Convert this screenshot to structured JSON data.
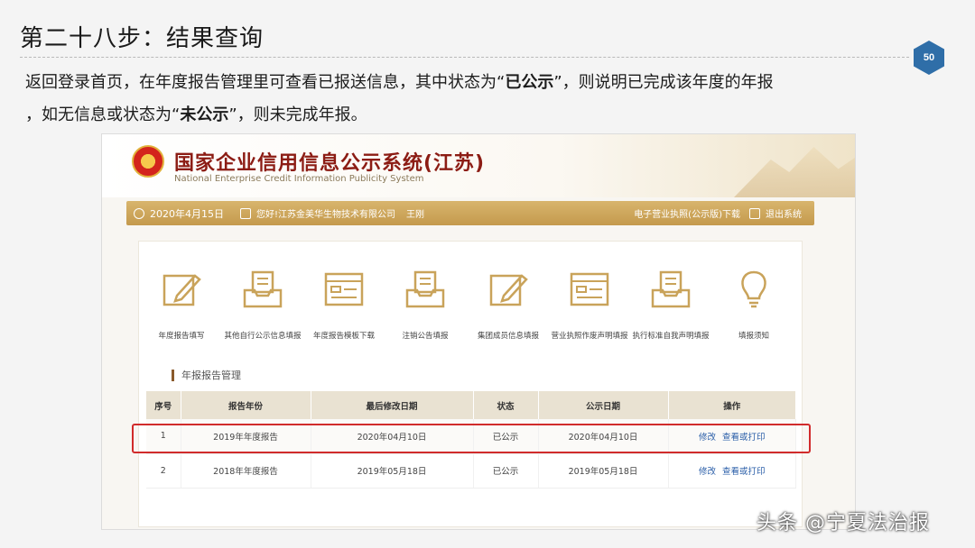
{
  "slide": {
    "title": "第二十八步：结果查询",
    "page_number": "50",
    "desc_part1": "返回登录首页，在年度报告管理里可查看已报送信息，其中状态为“",
    "desc_bold1": "已公示",
    "desc_part2": "”，则说明已完成该年度的年报",
    "desc_part3": "，如无信息或状态为“",
    "desc_bold2": "未公示",
    "desc_part4": "”，则未完成年报。"
  },
  "site": {
    "name": "国家企业信用信息公示系统(江苏)",
    "name_en": "National Enterprise Credit Information Publicity System",
    "date": "2020年4月15日",
    "company": "您好!江苏金美华生物技术有限公司",
    "user": "王刚",
    "license_download": "电子营业执照(公示版)下载",
    "logout": "退出系统"
  },
  "tiles": [
    {
      "label": "年度报告填写",
      "icon": "edit-form-icon"
    },
    {
      "label": "其他自行公示信息填报",
      "icon": "tray-document-icon"
    },
    {
      "label": "年度报告模板下载",
      "icon": "form-template-icon"
    },
    {
      "label": "注销公告填报",
      "icon": "tray-document-icon"
    },
    {
      "label": "集团成员信息填报",
      "icon": "edit-form-icon"
    },
    {
      "label": "营业执照作废声明填报",
      "icon": "form-template-icon"
    },
    {
      "label": "执行标准自我声明填报",
      "icon": "tray-document-icon"
    },
    {
      "label": "填报须知",
      "icon": "lightbulb-icon"
    }
  ],
  "section_title": "年报报告管理",
  "table": {
    "headers": [
      "序号",
      "报告年份",
      "最后修改日期",
      "状态",
      "公示日期",
      "操作"
    ],
    "rows": [
      {
        "no": "1",
        "year": "2019年年度报告",
        "modified": "2020年04月10日",
        "status": "已公示",
        "published": "2020年04月10日",
        "edit": "修改",
        "view": "查看或打印"
      },
      {
        "no": "2",
        "year": "2018年年度报告",
        "modified": "2019年05月18日",
        "status": "已公示",
        "published": "2019年05月18日",
        "edit": "修改",
        "view": "查看或打印"
      }
    ]
  },
  "watermark": "头条 @宁夏法治报",
  "colors": {
    "accent_gold": "#c9a35a",
    "brand_red": "#8c1c14",
    "highlight_red": "#d12b2b",
    "link_blue": "#2a5ea8"
  }
}
